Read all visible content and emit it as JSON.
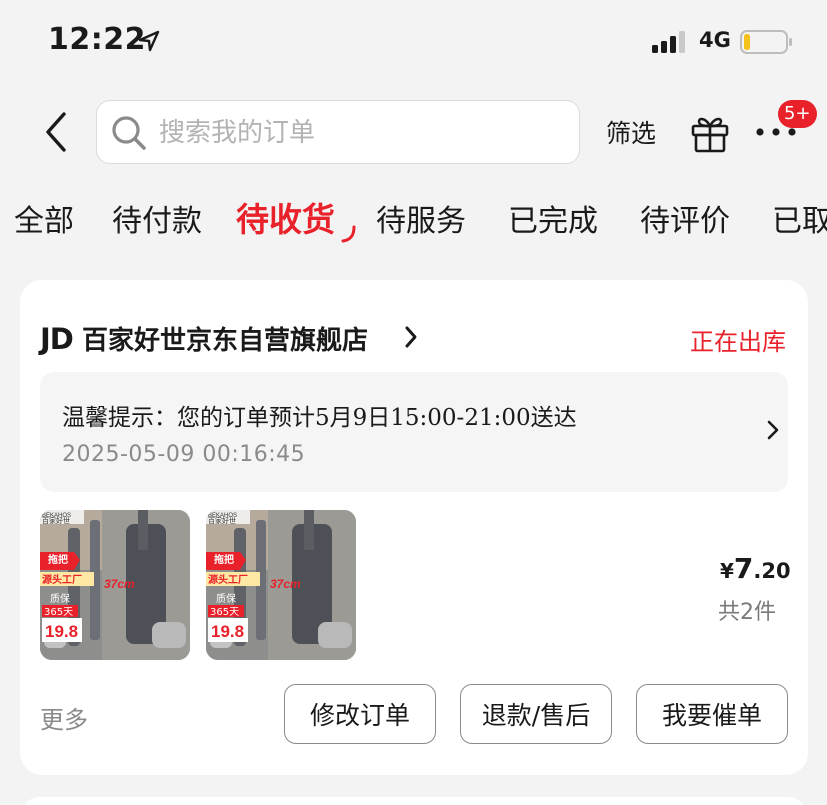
{
  "status_bar": {
    "time": "12:22",
    "network": "4G"
  },
  "header": {
    "search_placeholder": "搜索我的订单",
    "filter_label": "筛选",
    "notification_badge": "5+"
  },
  "tabs": [
    {
      "label": "全部",
      "active": false
    },
    {
      "label": "待付款",
      "active": false
    },
    {
      "label": "待收货",
      "active": true
    },
    {
      "label": "待服务",
      "active": false
    },
    {
      "label": "已完成",
      "active": false
    },
    {
      "label": "待评价",
      "active": false
    },
    {
      "label": "已取",
      "active": false
    }
  ],
  "order": {
    "store_logo": "JD",
    "store_name": "百家好世京东自营旗舰店",
    "status": "正在出库",
    "notice_text": "温馨提示：您的订单预计5月9日15:00-21:00送达",
    "notice_time": "2025-05-09 00:16:45",
    "products": [
      {
        "brand_tag": "BEKAHOS",
        "brand_cn": "百家好世",
        "promo_1": "拖把",
        "promo_2": "源头工厂",
        "size": "37cm",
        "warranty_1": "质保",
        "warranty_2": "365天",
        "price_tag": "19.8"
      },
      {
        "brand_tag": "BEKAHOS",
        "brand_cn": "百家好世",
        "promo_1": "拖把",
        "promo_2": "源头工厂",
        "size": "37cm",
        "warranty_1": "质保",
        "warranty_2": "365天",
        "price_tag": "19.8"
      }
    ],
    "price_currency": "¥",
    "price_integer": "7",
    "price_decimal": ".20",
    "item_count": "共2件",
    "more_label": "更多",
    "buttons": {
      "modify": "修改订单",
      "refund": "退款/售后",
      "urge": "我要催单"
    }
  },
  "colors": {
    "accent": "#e8212a",
    "page_bg": "#f3f3f3",
    "card_bg": "#ffffff"
  }
}
